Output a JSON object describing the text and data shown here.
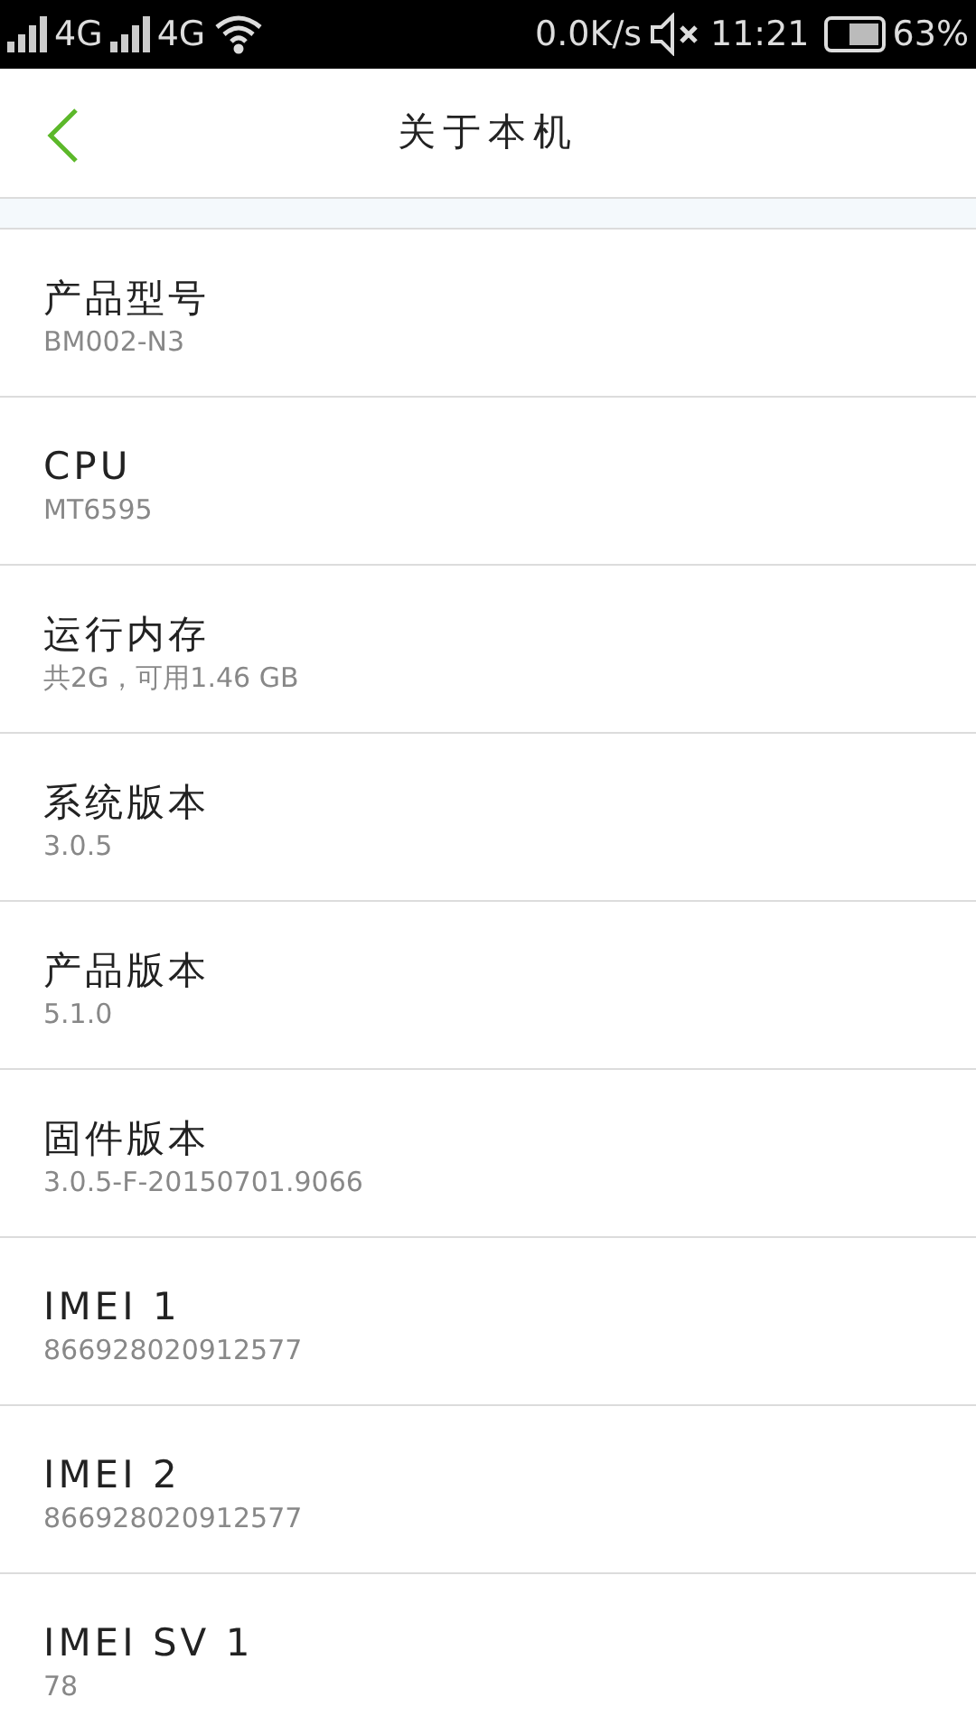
{
  "status_bar": {
    "network_1": "4G",
    "network_2": "4G",
    "speed": "0.0K/s",
    "time": "11:21",
    "battery": "63%"
  },
  "header": {
    "title": "关于本机"
  },
  "items": [
    {
      "label": "产品型号",
      "value": "BM002-N3"
    },
    {
      "label": "CPU",
      "value": "MT6595"
    },
    {
      "label": "运行内存",
      "value": "共2G，可用1.46 GB"
    },
    {
      "label": "系统版本",
      "value": "3.0.5"
    },
    {
      "label": "产品版本",
      "value": "5.1.0"
    },
    {
      "label": "固件版本",
      "value": "3.0.5-F-20150701.9066"
    },
    {
      "label": "IMEI 1",
      "value": "866928020912577"
    },
    {
      "label": "IMEI 2",
      "value": "866928020912577"
    },
    {
      "label": "IMEI SV 1",
      "value": "78"
    }
  ]
}
